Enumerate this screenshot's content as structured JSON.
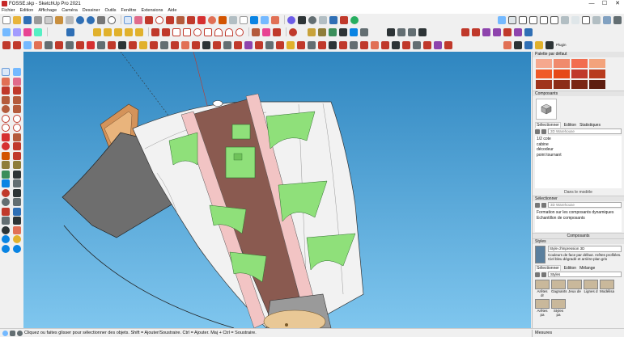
{
  "window": {
    "title": "FOSSE.skp - SketchUp Pro 2021",
    "controls": [
      "—",
      "☐",
      "✕"
    ]
  },
  "menu": [
    "Fichier",
    "Edition",
    "Affichage",
    "Caméra",
    "Dessiner",
    "Outils",
    "Fenêtre",
    "Extensions",
    "Aide"
  ],
  "toolbar": {
    "plugin_label": "Plugin"
  },
  "tray": {
    "palette_title": "Palette par défaut",
    "palette_colors": [
      "#f5a88e",
      "#f08a6c",
      "#f26d4f",
      "#f3a37c",
      "#f05a28",
      "#e64a19",
      "#c0392b",
      "#b83b1e",
      "#a0341c",
      "#8c2d18",
      "#7a2614",
      "#5e1e10"
    ],
    "components": {
      "title": "Composants",
      "tabs": [
        "Sélectionner",
        "Edition",
        "Statistiques"
      ],
      "search_placeholder": "3D Warehouse",
      "items": [
        "1/2 cote",
        "cabine",
        "décodeur",
        "point tournant"
      ],
      "model_label": "Dans le modèle"
    },
    "select2": {
      "title": "Sélectionner",
      "search_placeholder": "3D Warehouse",
      "items": [
        "Formation sur les composants dynamiques",
        "Echantillon de composants"
      ]
    },
    "components_footer": "Composants",
    "styles": {
      "title": "Styles",
      "style_name": "Style d'impression 3D",
      "style_desc": "Couleurs de face par défaut. Arêtes profilées. Ciel bleu dégradé et arrière-plan gris",
      "tabs": [
        "Sélectionner",
        "Edition",
        "Mélange"
      ],
      "dropdown": "Styles",
      "thumbs": [
        "Arêtes dr",
        "Gagnants",
        "Jeux de",
        "Lignes d",
        "Modélisa",
        "Arêtes pa",
        "Styles pa"
      ]
    }
  },
  "status": {
    "hint": "Cliquez ou faites glisser pour sélectionner des objets. Shift = Ajouter/Soustraire. Ctrl = Ajouter. Maj + Ctrl = Soustraire.",
    "measures_label": "Mesures"
  },
  "colors": {
    "sky_top": "#2f86c0",
    "sky_bottom": "#7fc6ee",
    "wall": "#f2f2f2",
    "green": "#8fe07a",
    "pink": "#f2c4c4",
    "brown": "#8a5a50",
    "gray": "#6e6e6e",
    "wood": "#d4935a"
  }
}
